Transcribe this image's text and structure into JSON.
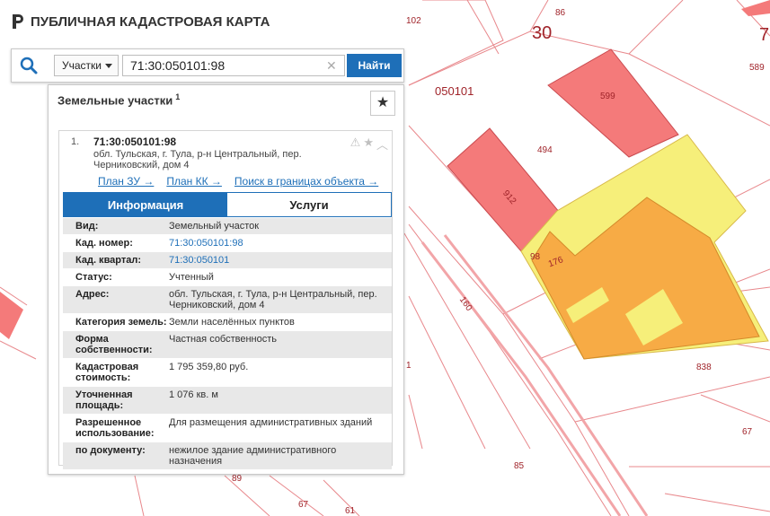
{
  "app": {
    "title": "ПУБЛИЧНАЯ КАДАСТРОВАЯ КАРТА"
  },
  "search": {
    "type_label": "Участки",
    "value": "71:30:050101:98",
    "find_label": "Найти"
  },
  "panel": {
    "title": "Земельные участки",
    "count": "1"
  },
  "result": {
    "index": "1.",
    "number": "71:30:050101:98",
    "address": "обл. Тульская, г. Тула, р-н Центральный, пер. Черниковский, дом 4",
    "links": [
      "План ЗУ →",
      "План КК →",
      "Поиск в границах объекта →"
    ],
    "tabs": {
      "info": "Информация",
      "services": "Услуги"
    },
    "rows": [
      {
        "k": "Вид:",
        "v": "Земельный участок"
      },
      {
        "k": "Кад. номер:",
        "v": "71:30:050101:98"
      },
      {
        "k": "Кад. квартал:",
        "v": "71:30:050101"
      },
      {
        "k": "Статус:",
        "v": "Учтенный"
      },
      {
        "k": "Адрес:",
        "v": "обл. Тульская, г. Тула, р-н Центральный, пер. Черниковский, дом 4"
      },
      {
        "k": "Категория земель:",
        "v": "Земли населённых пунктов"
      },
      {
        "k": "Форма собственности:",
        "v": "Частная собственность"
      },
      {
        "k": "Кадастровая стоимость:",
        "v": "1 795 359,80 руб."
      },
      {
        "k": "Уточненная площадь:",
        "v": "1 076 кв. м"
      },
      {
        "k": "Разрешенное использование:",
        "v": "Для размещения административных зданий"
      },
      {
        "k": "по документу:",
        "v": "нежилое здание административного назначения"
      }
    ]
  },
  "map": {
    "labels": {
      "l102": "102",
      "l86": "86",
      "l30": "30",
      "l7": "7",
      "l589": "589",
      "l050101": "050101",
      "l599": "599",
      "l494": "494",
      "l912": "912",
      "l98": "98",
      "l176": "176",
      "l160": "160",
      "l838": "838",
      "l67a": "67",
      "l85": "85",
      "l89": "89",
      "l67b": "67",
      "l61": "61",
      "l1": "1"
    }
  },
  "colors": {
    "accent": "#1e6fb8",
    "parcel_red": "#f47a7a",
    "parcel_orange": "#f7ab45",
    "parcel_yellow": "#f6ef7a",
    "boundary": "#e8888c"
  }
}
